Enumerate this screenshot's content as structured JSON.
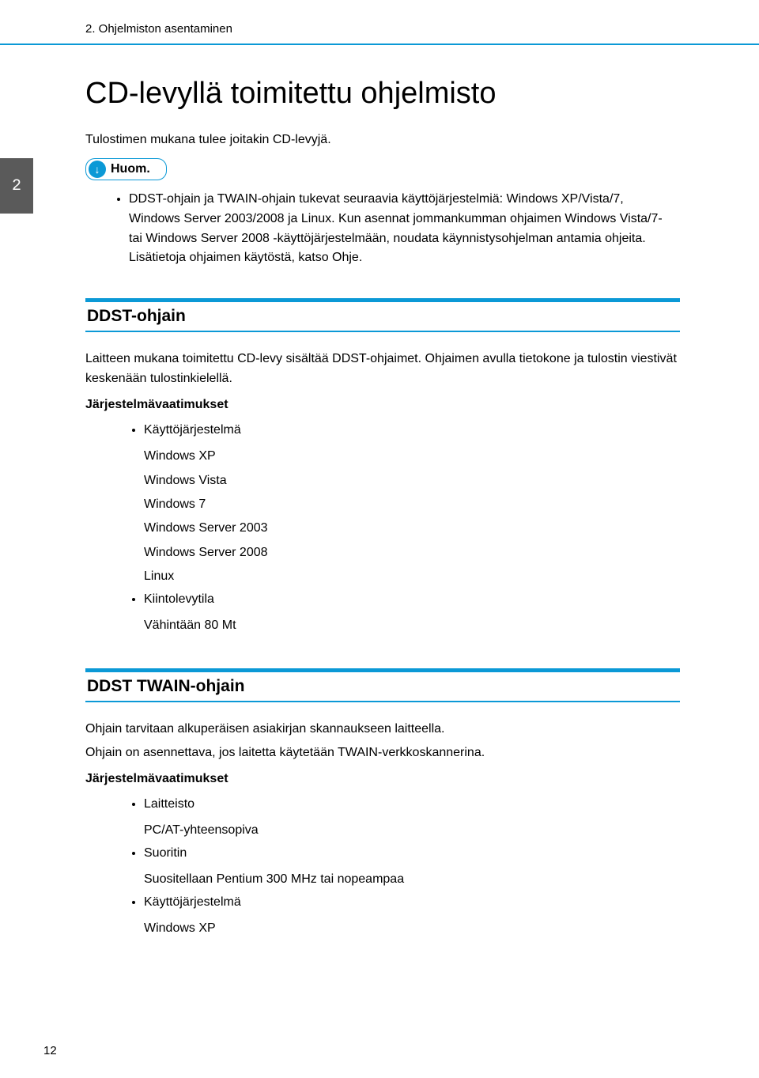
{
  "header": {
    "breadcrumb": "2. Ohjelmiston asentaminen"
  },
  "chapter_tab": "2",
  "title": "CD-levyllä toimitettu ohjelmisto",
  "intro": "Tulostimen mukana tulee joitakin CD-levyjä.",
  "note": {
    "label": "Huom.",
    "items": [
      "DDST-ohjain ja TWAIN-ohjain tukevat seuraavia käyttöjärjestelmiä: Windows XP/Vista/7, Windows Server 2003/2008 ja Linux. Kun asennat jommankumman ohjaimen Windows Vista/7- tai Windows Server 2008 -käyttöjärjestelmään, noudata käynnistysohjelman antamia ohjeita. Lisätietoja ohjaimen käytöstä, katso Ohje."
    ]
  },
  "sections": [
    {
      "heading": "DDST-ohjain",
      "paragraphs": [
        "Laitteen mukana toimitettu CD-levy sisältää DDST-ohjaimet. Ohjaimen avulla tietokone ja tulostin viestivät keskenään tulostinkielellä."
      ],
      "sysreq_label": "Järjestelmävaatimukset",
      "requirements": [
        {
          "label": "Käyttöjärjestelmä",
          "subs": [
            "Windows XP",
            "Windows Vista",
            "Windows 7",
            "Windows Server 2003",
            "Windows Server 2008",
            "Linux"
          ]
        },
        {
          "label": "Kiintolevytila",
          "subs": [
            "Vähintään 80 Mt"
          ]
        }
      ]
    },
    {
      "heading": "DDST TWAIN-ohjain",
      "paragraphs": [
        "Ohjain tarvitaan alkuperäisen asiakirjan skannaukseen laitteella.",
        "Ohjain on asennettava, jos laitetta käytetään TWAIN-verkkoskannerina."
      ],
      "sysreq_label": "Järjestelmävaatimukset",
      "requirements": [
        {
          "label": "Laitteisto",
          "subs": [
            "PC/AT-yhteensopiva"
          ]
        },
        {
          "label": "Suoritin",
          "subs": [
            "Suositellaan Pentium 300 MHz tai nopeampaa"
          ]
        },
        {
          "label": "Käyttöjärjestelmä",
          "subs": [
            "Windows XP"
          ]
        }
      ]
    }
  ],
  "page_number": "12"
}
